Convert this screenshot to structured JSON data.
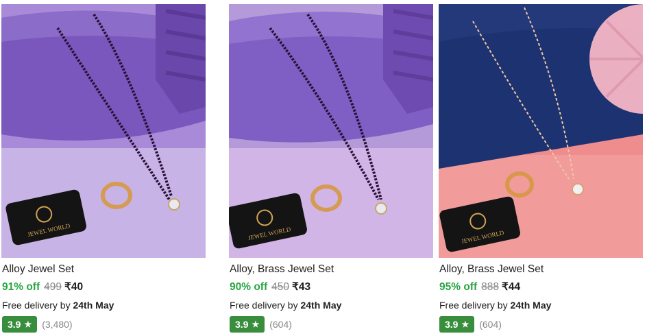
{
  "products": [
    {
      "title": "Alloy Jewel Set",
      "discount": "91% off",
      "mrp": "499",
      "price": "₹40",
      "delivery_prefix": "Free delivery by",
      "delivery_date": "24th May",
      "rating": "3.9",
      "rating_count": "(3,480)",
      "theme": "purple",
      "brand_text": "JEWEL WORLD"
    },
    {
      "title": "Alloy, Brass Jewel Set",
      "discount": "90% off",
      "mrp": "450",
      "price": "₹43",
      "delivery_prefix": "Free delivery by",
      "delivery_date": "24th May",
      "rating": "3.9",
      "rating_count": "(604)",
      "theme": "purple",
      "brand_text": "JEWEL WORLD"
    },
    {
      "title": "Alloy, Brass Jewel Set",
      "discount": "95% off",
      "mrp": "888",
      "price": "₹44",
      "delivery_prefix": "Free delivery by",
      "delivery_date": "24th May",
      "rating": "3.9",
      "rating_count": "(604)",
      "theme": "pink",
      "brand_text": "JEWEL WORLD"
    }
  ],
  "colors": {
    "discount_green": "#26a541",
    "rating_green": "#388e3c",
    "muted_gray": "#878787"
  },
  "icons": {
    "rating_star": "star-icon"
  }
}
